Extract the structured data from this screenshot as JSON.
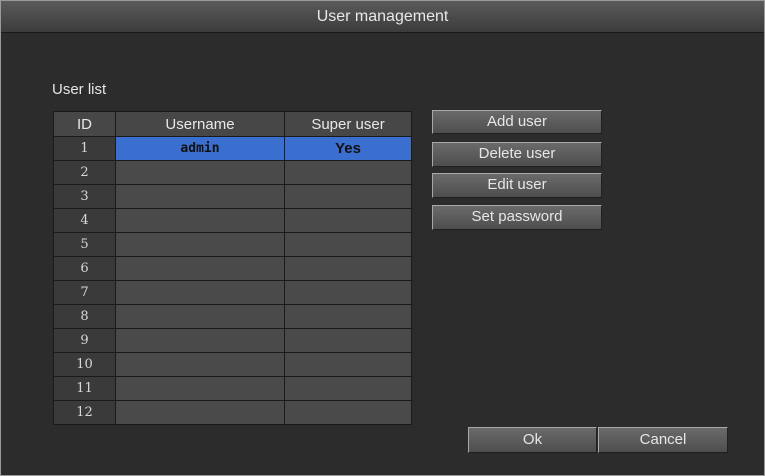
{
  "dialog": {
    "title": "User management"
  },
  "user_list": {
    "label": "User list",
    "columns": [
      "ID",
      "Username",
      "Super user"
    ],
    "rows": [
      {
        "id": "1",
        "username": "admin",
        "super": "Yes",
        "selected": true
      },
      {
        "id": "2",
        "username": "",
        "super": ""
      },
      {
        "id": "3",
        "username": "",
        "super": ""
      },
      {
        "id": "4",
        "username": "",
        "super": ""
      },
      {
        "id": "5",
        "username": "",
        "super": ""
      },
      {
        "id": "6",
        "username": "",
        "super": ""
      },
      {
        "id": "7",
        "username": "",
        "super": ""
      },
      {
        "id": "8",
        "username": "",
        "super": ""
      },
      {
        "id": "9",
        "username": "",
        "super": ""
      },
      {
        "id": "10",
        "username": "",
        "super": ""
      },
      {
        "id": "11",
        "username": "",
        "super": ""
      },
      {
        "id": "12",
        "username": "",
        "super": ""
      }
    ]
  },
  "actions": {
    "add": "Add user",
    "delete": "Delete user",
    "edit": "Edit user",
    "password": "Set password"
  },
  "footer": {
    "ok": "Ok",
    "cancel": "Cancel"
  },
  "colors": {
    "selection": "#3a6fd0",
    "background": "#2c2c2c"
  }
}
